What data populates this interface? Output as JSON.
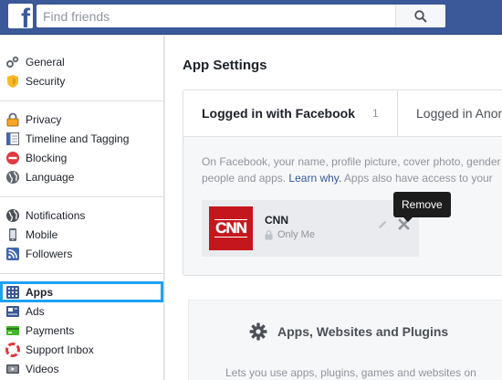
{
  "search": {
    "placeholder": "Find friends"
  },
  "sidebar": {
    "group1": [
      {
        "label": "General",
        "icon": "gears-icon"
      },
      {
        "label": "Security",
        "icon": "shield-icon"
      }
    ],
    "group2": [
      {
        "label": "Privacy",
        "icon": "padlock-icon"
      },
      {
        "label": "Timeline and Tagging",
        "icon": "timeline-icon"
      },
      {
        "label": "Blocking",
        "icon": "block-icon"
      },
      {
        "label": "Language",
        "icon": "globe-icon"
      }
    ],
    "group3": [
      {
        "label": "Notifications",
        "icon": "globe-icon"
      },
      {
        "label": "Mobile",
        "icon": "mobile-icon"
      },
      {
        "label": "Followers",
        "icon": "rss-icon"
      }
    ],
    "group4": [
      {
        "label": "Apps",
        "icon": "apps-icon",
        "active": true
      },
      {
        "label": "Ads",
        "icon": "ads-icon"
      },
      {
        "label": "Payments",
        "icon": "payments-icon"
      },
      {
        "label": "Support Inbox",
        "icon": "lifebuoy-icon"
      },
      {
        "label": "Videos",
        "icon": "video-icon"
      }
    ]
  },
  "main": {
    "title": "App Settings",
    "tabs": {
      "logged_in": "Logged in with Facebook",
      "logged_in_count": "1",
      "logged_anon": "Logged in Anon"
    },
    "description": {
      "line1": "On Facebook, your name, profile picture, cover photo, gender",
      "line2_prefix": "people and apps. ",
      "learn_why": "Learn why.",
      "line2_suffix": " Apps also have access to your"
    },
    "app": {
      "logo_text": "CNN",
      "name": "CNN",
      "privacy": "Only Me"
    },
    "tooltip": "Remove",
    "section2": {
      "title": "Apps, Websites and Plugins",
      "desc": "Lets you use apps, plugins, games and websites on"
    }
  },
  "colors": {
    "topbar": "#3b5998",
    "active_outline": "#1ea1f2",
    "link": "#365899",
    "cnn_red": "#c4161c"
  }
}
